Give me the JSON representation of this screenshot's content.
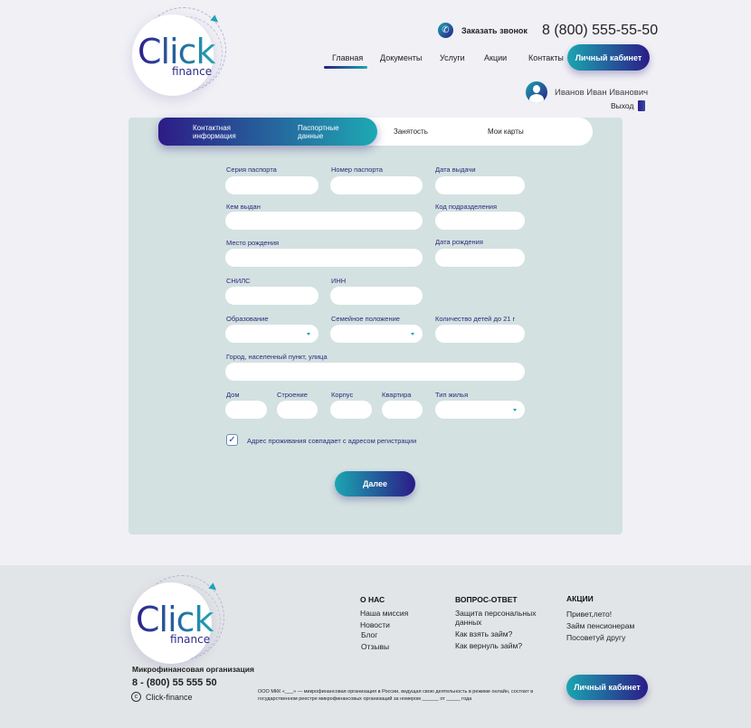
{
  "header": {
    "logo_text": "Click",
    "logo_sub": "finance",
    "callback": "Заказать звонок",
    "phone": "8 (800) 555-55-50",
    "nav": [
      "Главная",
      "Документы",
      "Услуги",
      "Акции",
      "Контакты"
    ],
    "cabinet": "Личный кабинет",
    "user_name": "Иванов Иван Иванович",
    "logout": "Выход"
  },
  "tabs": [
    {
      "label": "Контактная информация"
    },
    {
      "label": "Паспортные данные"
    },
    {
      "label": "Занятость"
    },
    {
      "label": "Мои карты"
    }
  ],
  "form": {
    "passport_series": "Серия паспорта",
    "passport_number": "Номер паспорта",
    "issue_date": "Дата выдачи",
    "issued_by": "Кем выдан",
    "division_code": "Код подразделения",
    "birth_place": "Место рождения",
    "birth_date": "Дата рождения",
    "snils": "СНИЛС",
    "inn": "ИНН",
    "education": "Образование",
    "marital": "Семейное положение",
    "children": "Количество детей до 21 г",
    "address": "Город, населенный пункт, улица",
    "house": "Дом",
    "building": "Строение",
    "block": "Корпус",
    "flat": "Квартира",
    "housing": "Тип жилья",
    "same_address": "Адрес проживания совпадает с адресом регистрации",
    "same_address_checked": true,
    "next": "Далее"
  },
  "footer": {
    "logo_text": "Click",
    "logo_sub": "finance",
    "org": "Микрофинансовая организация",
    "phone": "8 - (800) 55 555 50",
    "copyright": "Click-finance",
    "copyright_symbol": "c",
    "cols": [
      {
        "title": "О НАС",
        "items": [
          "Наша миссия",
          "Новости",
          "Блог",
          "Отзывы"
        ]
      },
      {
        "title": "ВОПРОС-ОТВЕТ",
        "items": [
          "Защита персональных данных",
          "Как взять займ?",
          "Как вернуль займ?"
        ]
      },
      {
        "title": "АКЦИИ",
        "items": [
          "Привет,лето!",
          "Займ пенсионерам",
          "Посоветуй другу"
        ]
      }
    ],
    "legal": "ООО МКК «___» — микрофинансовая организация в России, ведущая свою деятельность в режиме онлайн, состоит в государственном реестре микрофинансовых организаций за номером ______ от _____ года",
    "cabinet": "Личный кабинет"
  },
  "colors": {
    "accent_dark": "#2b1c87",
    "accent_teal": "#1ba5b1",
    "panel": "#d3e1e1"
  }
}
